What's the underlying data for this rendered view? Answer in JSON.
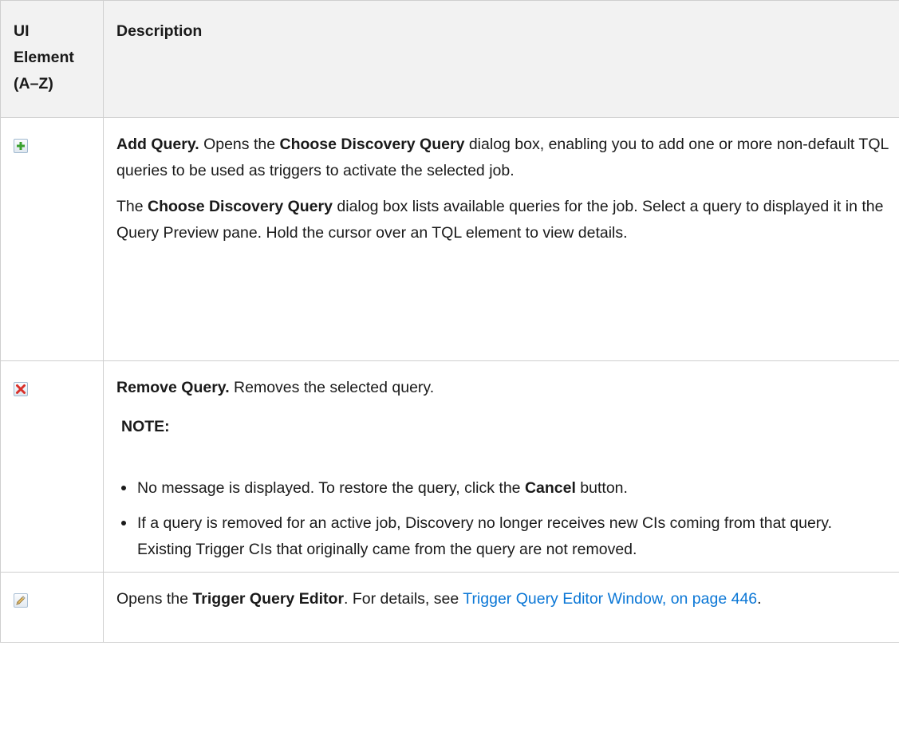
{
  "table": {
    "header": {
      "col1_line1": "UI",
      "col1_line2": "Element",
      "col1_line3": "(A–Z)",
      "col2": "Description"
    },
    "rows": [
      {
        "icon": "add-plus-icon",
        "title": "Add Query.",
        "p1_a": " Opens the ",
        "p1_b": "Choose Discovery Query",
        "p1_c": " dialog box, enabling you to add one or more non-default TQL queries to be used as triggers to activate the selected job.",
        "p2_a": "The ",
        "p2_b": "Choose Discovery Query",
        "p2_c": " dialog box lists available queries for the job. Select a query to displayed it in the Query Preview pane. Hold the cursor over an TQL element to view details."
      },
      {
        "icon": "remove-x-icon",
        "title": "Remove Query.",
        "p1": " Removes the selected query.",
        "note": "NOTE:",
        "bullet1_a": "No message is displayed. To restore the query, click the ",
        "bullet1_b": "Cancel",
        "bullet1_c": " button.",
        "bullet2": "If a query is removed for an active job, Discovery no longer receives new CIs coming from that query. Existing Trigger CIs that originally came from the query are not removed."
      },
      {
        "icon": "edit-pencil-icon",
        "p1_a": "Opens the ",
        "p1_b": "Trigger Query Editor",
        "p1_c": ". For details, see ",
        "link": "Trigger Query Editor Window, on page 446",
        "p1_d": "."
      }
    ]
  },
  "colors": {
    "link": "#0b77d6",
    "header_bg": "#f2f2f2",
    "border": "#cfcfcf",
    "add_icon_green": "#3aa12f",
    "remove_icon_red": "#d9302a"
  }
}
